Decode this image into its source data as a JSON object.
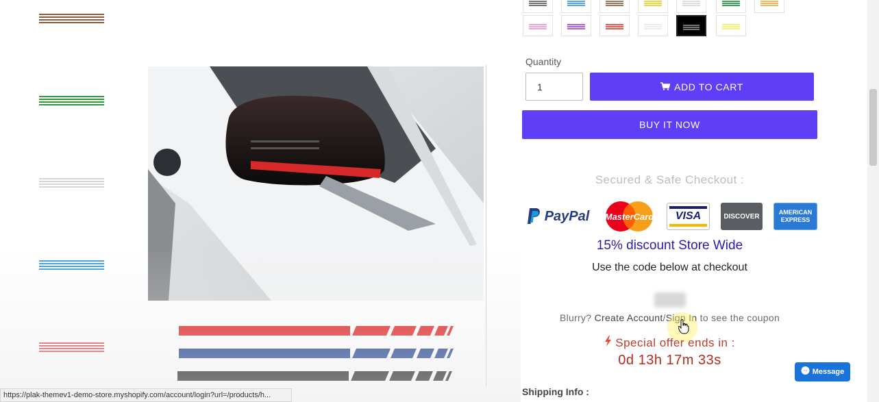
{
  "product": {
    "quantity_label": "Quantity",
    "quantity_value": "1",
    "add_to_cart_label": "ADD TO CART",
    "buy_now_label": "BUY IT NOW"
  },
  "checkout": {
    "secure_title": "Secured & Safe Checkout :",
    "payment_methods": [
      "PayPal",
      "MasterCard",
      "VISA",
      "DISCOVER",
      "AMERICAN EXPRESS"
    ],
    "discount_text": "15% discount Store Wide",
    "use_code_text": "Use the code below at checkout",
    "blurry_prefix": "Blurry?",
    "create_account_link": "Create Account",
    "separator": "/",
    "sign_in_link": "Sign In",
    "blurry_suffix": "to see the coupon",
    "offer_text": "Special offer ends in :",
    "countdown": "0d 13h 17m 33s"
  },
  "shipping_title": "Shipping Info :",
  "status_url": "https://plak-themev1-demo-store.myshopify.com/account/login?url=/products/h...",
  "chat_label": "Message",
  "colors": {
    "accent": "#5f3ef7",
    "discount": "#2a1aa8",
    "offer": "#c0392b",
    "chat": "#1a73d9"
  },
  "icons": {
    "cart": "cart-icon",
    "bolt": "lightning-icon",
    "chat": "messenger-icon"
  }
}
